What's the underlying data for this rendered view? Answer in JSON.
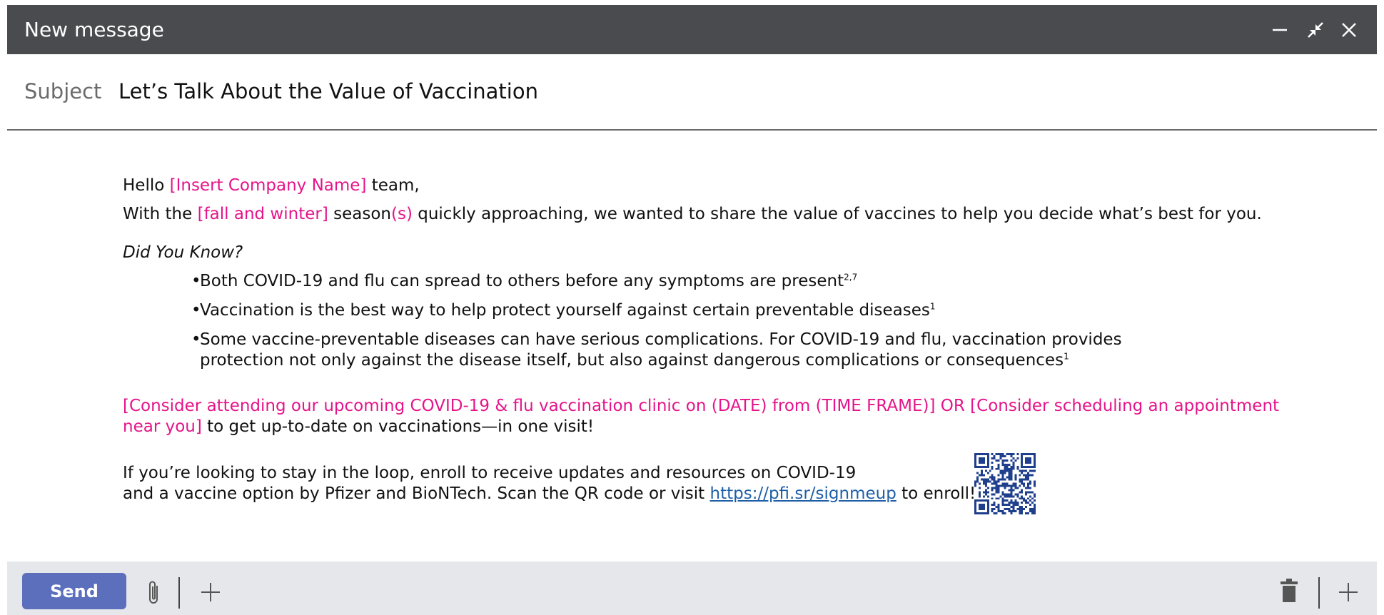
{
  "window": {
    "title": "New message"
  },
  "subject": {
    "label": "Subject",
    "value": "Let’s Talk About the Value of Vaccination"
  },
  "body": {
    "greeting": {
      "prefix": "Hello ",
      "company": "[Insert Company Name]",
      "suffix": " team,"
    },
    "intro": {
      "prefix": "With the ",
      "season_placeholder": "[fall and winter]",
      "season_word": " season",
      "plural": "(s)",
      "rest": " quickly approaching, we wanted to share the value of vaccines to help you decide what’s best for you."
    },
    "did_you_know": "Did You Know?",
    "bullets": [
      {
        "text": "Both COVID-19 and flu can spread to others before any symptoms are present",
        "sup": "2,7"
      },
      {
        "text": "Vaccination is the best way to help protect yourself against certain preventable diseases",
        "sup": "1"
      },
      {
        "line1": "Some vaccine-preventable diseases can have serious complications. For COVID-19 and flu, vaccination provides",
        "line2": "protection not only against the disease itself, but also against dangerous complications or consequences",
        "sup": "1"
      }
    ],
    "clinic": {
      "line1": "[Consider attending our upcoming COVID-19 & flu vaccination clinic on (DATE) from (TIME FRAME)] OR [Consider scheduling an appointment",
      "line2_pink": "near you]",
      "line2_rest": " to get up-to-date on vaccinations—in one visit!"
    },
    "enroll": {
      "line1": "If you’re looking to stay in the loop, enroll to receive updates and resources on COVID-19",
      "line2_prefix": "and a vaccine option by Pfizer and BioNTech. Scan the QR code or visit ",
      "link": "https://pfi.sr/signmeup",
      "line2_suffix": " to enroll!"
    },
    "qr_icon": "qr-code"
  },
  "footer": {
    "send_label": "Send"
  },
  "icons": {
    "minimize": "minimize-icon",
    "collapse": "collapse-icon",
    "close": "close-icon",
    "attach": "paperclip-icon",
    "add": "plus-icon",
    "delete": "trash-icon"
  },
  "colors": {
    "titlebar": "#4a4b4e",
    "placeholder": "#e5148a",
    "send": "#5b6fbc",
    "link": "#1f5fa8",
    "footer": "#e6e7ea"
  }
}
